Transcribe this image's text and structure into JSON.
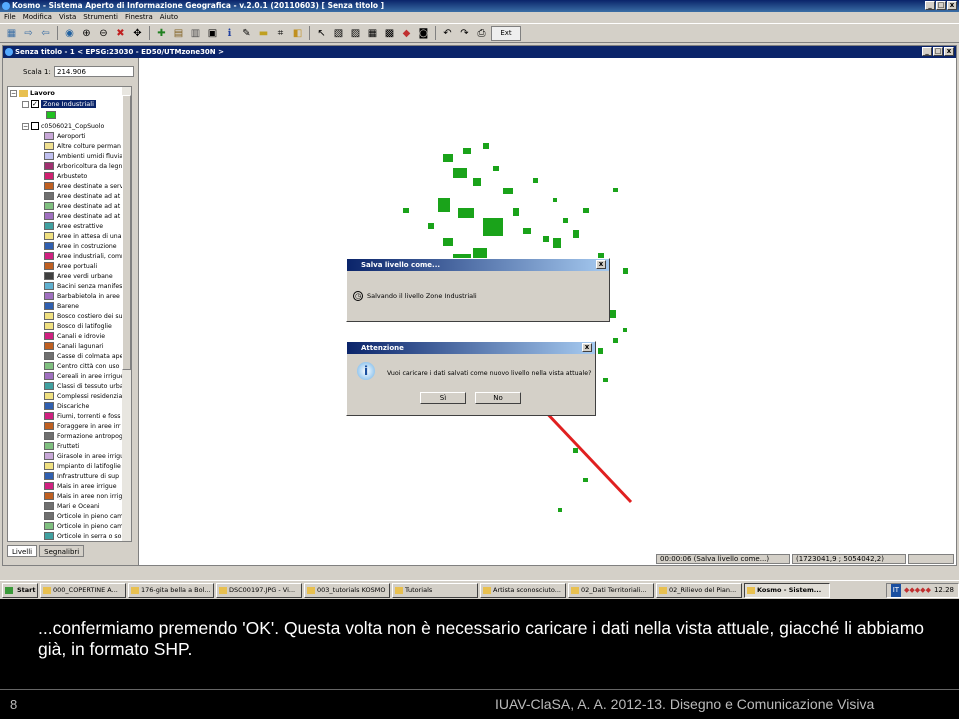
{
  "app": {
    "title": "Kosmo - Sistema Aperto di Informazione Geografica - v.2.0.1 (20110603) [ Senza titolo ]",
    "window_controls": [
      "_",
      "□",
      "x"
    ]
  },
  "menu": [
    "File",
    "Modifica",
    "Vista",
    "Strumenti",
    "Finestra",
    "Aiuto"
  ],
  "toolbar": {
    "ext_label": "Ext"
  },
  "view": {
    "title": "Senza titolo - 1 < EPSG:23030 - ED50/UTMzone30N >",
    "scale_label": "Scala 1:",
    "scale_value": "214.906"
  },
  "layers": {
    "group": "Lavoro",
    "layer1": "Zone Industriali",
    "layer2": "c0506021_CopSuolo",
    "legend": [
      {
        "label": "Aeroporti",
        "color": "#c8a8d8"
      },
      {
        "label": "Altre colture perman",
        "color": "#f0e090"
      },
      {
        "label": "Ambienti umidi fluvial",
        "color": "#c0c0f0"
      },
      {
        "label": "Arboricoltura da legn",
        "color": "#a03070"
      },
      {
        "label": "Arbusteto",
        "color": "#d02070"
      },
      {
        "label": "Aree destinate a serv",
        "color": "#c06020"
      },
      {
        "label": "Aree destinate ad at",
        "color": "#707070"
      },
      {
        "label": "Aree destinate ad at",
        "color": "#80c080"
      },
      {
        "label": "Aree destinate ad at",
        "color": "#a070c0"
      },
      {
        "label": "Aree estrattive",
        "color": "#40a0a0"
      },
      {
        "label": "Aree in attesa di una",
        "color": "#f0e080"
      },
      {
        "label": "Aree in costruzione",
        "color": "#3060b0"
      },
      {
        "label": "Aree industriali, comm",
        "color": "#d02080"
      },
      {
        "label": "Aree portuali",
        "color": "#c06020"
      },
      {
        "label": "Aree verdi urbane",
        "color": "#404040"
      },
      {
        "label": "Bacini senza manifest",
        "color": "#60b0d0"
      },
      {
        "label": "Barbabietola in aree",
        "color": "#a070c0"
      },
      {
        "label": "Barene",
        "color": "#3060b0"
      },
      {
        "label": "Bosco costiero dei su",
        "color": "#f0e080"
      },
      {
        "label": "Bosco di latifoglie",
        "color": "#f0e080"
      },
      {
        "label": "Canali e idrovie",
        "color": "#d02080"
      },
      {
        "label": "Canali lagunari",
        "color": "#c06020"
      },
      {
        "label": "Casse di colmata ape",
        "color": "#707070"
      },
      {
        "label": "Centro città con uso",
        "color": "#80c080"
      },
      {
        "label": "Cereali in aree irrigue",
        "color": "#a070c0"
      },
      {
        "label": "Classi di tessuto urba",
        "color": "#40a0a0"
      },
      {
        "label": "Complessi residenzial",
        "color": "#f0e080"
      },
      {
        "label": "Discariche",
        "color": "#3060b0"
      },
      {
        "label": "Fiumi, torrenti e foss",
        "color": "#d02080"
      },
      {
        "label": "Foraggere in aree irr",
        "color": "#c06020"
      },
      {
        "label": "Formazione antropog",
        "color": "#707070"
      },
      {
        "label": "Frutteti",
        "color": "#80c080"
      },
      {
        "label": "Girasole in aree irrigu",
        "color": "#c8a8d8"
      },
      {
        "label": "Impianto di latifoglie",
        "color": "#f0e080"
      },
      {
        "label": "Infrastrutture di sup",
        "color": "#3060b0"
      },
      {
        "label": "Mais in aree irrigue",
        "color": "#d02080"
      },
      {
        "label": "Mais in aree non irrig",
        "color": "#c06020"
      },
      {
        "label": "Mari e Oceani",
        "color": "#707070"
      },
      {
        "label": "Orticole in pieno cam",
        "color": "#707070"
      },
      {
        "label": "Orticole in pieno cam",
        "color": "#80c080"
      },
      {
        "label": "Orticole in serra o so",
        "color": "#40a0a0"
      }
    ],
    "tab_livelli": "Livelli",
    "tab_segnalibri": "Segnalibri"
  },
  "status": {
    "time": "00:00:06 (Salva livello come...)",
    "coords": "(1723041,9 ; 5054042,2)"
  },
  "dialog_save": {
    "title": "Salva livello come...",
    "message": "Salvando il livello Zone Industriali"
  },
  "dialog_confirm": {
    "title": "Attenzione",
    "message": "Vuoi caricare i dati salvati come nuovo livello nella vista attuale?",
    "yes": "Sì",
    "no": "No"
  },
  "taskbar": {
    "start": "Start",
    "tasks": [
      "000_COPERTINE A...",
      "176-gita bella a Bol...",
      "DSC00197.JPG - Vi...",
      "003_tutorials KOSMO",
      "Tutorials",
      "Artista sconosciuto...",
      "02_Dati Territoriali...",
      "02_Rilievo del Pian...",
      "Kosmo - Sistem..."
    ],
    "lang": "IT",
    "clock": "12.28"
  },
  "slide": {
    "caption": "...confermiamo premendo 'OK'. Questa volta non è necessario caricare i dati nella vista attuale, giacché li abbiamo già, in formato SHP.",
    "number": "8",
    "footer": "IUAV-ClaSA, A. A. 2012-13. Disegno e Comunicazione Visiva"
  }
}
